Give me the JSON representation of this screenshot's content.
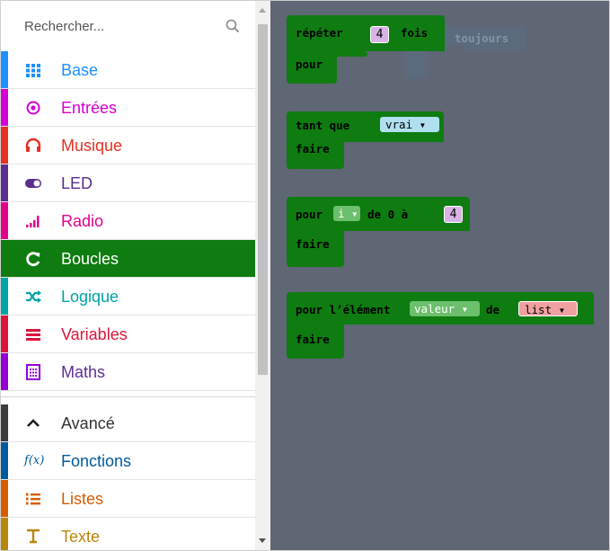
{
  "search": {
    "placeholder": "Rechercher..."
  },
  "categories": [
    {
      "label": "Base",
      "icon": "grid-icon",
      "color": "#1e90ff"
    },
    {
      "label": "Entrées",
      "icon": "target-icon",
      "color": "#d400d4"
    },
    {
      "label": "Musique",
      "icon": "headphones-icon",
      "color": "#e63022"
    },
    {
      "label": "LED",
      "icon": "toggle-icon",
      "color": "#5c2d91"
    },
    {
      "label": "Radio",
      "icon": "signal-icon",
      "color": "#e3008c"
    },
    {
      "label": "Boucles",
      "icon": "loop-icon",
      "color": "#00aa00"
    },
    {
      "label": "Logique",
      "icon": "shuffle-icon",
      "color": "#00a4a6"
    },
    {
      "label": "Variables",
      "icon": "list-lines-icon",
      "color": "#dc143c"
    },
    {
      "label": "Maths",
      "icon": "calculator-icon",
      "color": "#9400d3"
    }
  ],
  "advanced": [
    {
      "label": "Avancé",
      "icon": "chevron-up-icon",
      "color": "#3c3c3c"
    },
    {
      "label": "Fonctions",
      "icon": "function-icon",
      "color": "#005a9e"
    },
    {
      "label": "Listes",
      "icon": "numbered-list-icon",
      "color": "#d65c00"
    },
    {
      "label": "Texte",
      "icon": "text-icon",
      "color": "#b8860b"
    }
  ],
  "selected_category": "Boucles",
  "blocks": {
    "repeat": {
      "keyword": "répéter",
      "count": "4",
      "suffix": "fois",
      "body": "pour"
    },
    "forever_ghost": {
      "label": "toujours"
    },
    "while": {
      "keyword": "tant que",
      "condition": "vrai ▾",
      "body": "faire"
    },
    "for_range": {
      "keyword": "pour",
      "var": "i ▾",
      "mid": "de 0 à",
      "count": "4",
      "body": "faire"
    },
    "for_each": {
      "keyword": "pour l’élément",
      "var": "valeur ▾",
      "mid": "de",
      "list": "list ▾",
      "body": "faire"
    }
  },
  "colors": {
    "loops": "#0e7c10",
    "workspace": "#5f6674",
    "number_block": "#d8b3e6",
    "logic_block": "#b0e0f0",
    "list_block": "#f0a0a0",
    "variable_pill": "#6cbf6c"
  }
}
